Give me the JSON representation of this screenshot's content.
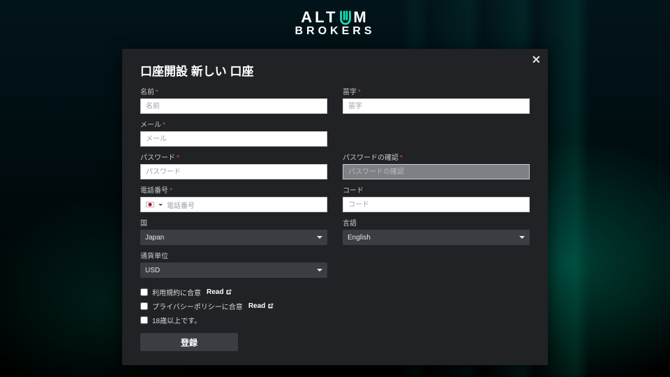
{
  "brand": {
    "line1_a": "ALT",
    "line1_b": "M",
    "line2": "BROKERS"
  },
  "panel": {
    "title": "口座開設 新しい 口座",
    "close": "✕",
    "fields": {
      "first_name": {
        "label": "名前",
        "placeholder": "名前",
        "required": true
      },
      "last_name": {
        "label": "苗字",
        "placeholder": "苗字",
        "required": true
      },
      "email": {
        "label": "メール",
        "placeholder": "メール",
        "required": true
      },
      "password": {
        "label": "パスワード",
        "placeholder": "パスワード",
        "required": true
      },
      "password2": {
        "label": "パスワードの確認",
        "placeholder": "パスワードの確認",
        "required": true
      },
      "phone": {
        "label": "電話番号",
        "placeholder": "電話番号",
        "required": true
      },
      "code": {
        "label": "コード",
        "placeholder": "コード",
        "required": false
      },
      "country": {
        "label": "国",
        "value": "Japan"
      },
      "language": {
        "label": "言語",
        "value": "English"
      },
      "currency": {
        "label": "通貨単位",
        "value": "USD"
      }
    },
    "checks": {
      "terms": {
        "label": "利用規約に合意",
        "read": "Read"
      },
      "privacy": {
        "label": "プライバシーポリシーに合意",
        "read": "Read"
      },
      "age": {
        "label": "18歳以上です。"
      }
    },
    "submit": "登録",
    "required_mark": "*"
  }
}
